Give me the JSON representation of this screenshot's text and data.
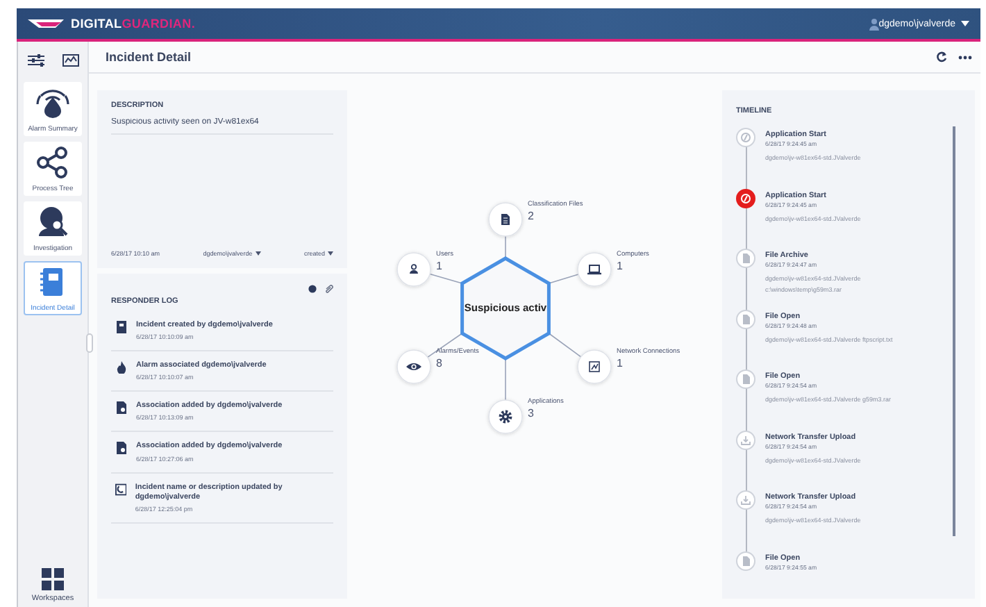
{
  "header": {
    "logo_primary": "DIGITAL",
    "logo_accent": "GUARDIAN.",
    "user": "dgdemo\\jvalverde"
  },
  "sidebar": {
    "tiles": [
      {
        "label": "Alarm Summary",
        "kind": "alarm",
        "selected": false
      },
      {
        "label": "Process Tree",
        "kind": "tree",
        "selected": false
      },
      {
        "label": "Investigation",
        "kind": "investigation",
        "selected": false
      },
      {
        "label": "Incident Detail",
        "kind": "incident",
        "selected": true
      }
    ],
    "workspaces": "Workspaces"
  },
  "page_title": "Incident Detail",
  "description": {
    "heading": "DESCRIPTION",
    "text": "Suspicious activity seen on JV-w81ex64",
    "date": "6/28/17 10:10 am",
    "owner": "dgdemo\\jvalverde",
    "status": "created"
  },
  "responder_log": {
    "heading": "RESPONDER LOG",
    "entries": [
      {
        "kind": "incident",
        "text": "Incident created by dgdemo\\jvalverde",
        "time": "6/28/17 10:10:09 am"
      },
      {
        "kind": "alarm",
        "text": "Alarm associated dgdemo\\jvalverde",
        "time": "6/28/17 10:10:07 am"
      },
      {
        "kind": "association",
        "text": "Association added by dgdemo\\jvalverde",
        "time": "6/28/17 10:13:09 am"
      },
      {
        "kind": "association",
        "text": "Association added by dgdemo\\jvalverde",
        "time": "6/28/17 10:27:06 am"
      },
      {
        "kind": "update",
        "text": "Incident name or description updated by dgdemo\\jvalverde",
        "time": "6/28/17 12:25:04 pm"
      }
    ]
  },
  "graph": {
    "center": "Suspicious activ",
    "nodes": [
      {
        "kind": "files",
        "label": "Classification Files",
        "count": "2"
      },
      {
        "kind": "users",
        "label": "Users",
        "count": "1"
      },
      {
        "kind": "computers",
        "label": "Computers",
        "count": "1"
      },
      {
        "kind": "alarms",
        "label": "Alarms/Events",
        "count": "8"
      },
      {
        "kind": "network",
        "label": "Network Connections",
        "count": "1"
      },
      {
        "kind": "applications",
        "label": "Applications",
        "count": "3"
      }
    ]
  },
  "timeline": {
    "heading": "TIMELINE",
    "events": [
      {
        "kind": "app",
        "alert": false,
        "title": "Application Start",
        "time": "6/28/17 9:24:45 am",
        "details": [
          "dgdemo\\jv-w81ex64-std.JValverde"
        ]
      },
      {
        "kind": "app",
        "alert": true,
        "title": "Application Start",
        "time": "6/28/17 9:24:45 am",
        "details": [
          "dgdemo\\jv-w81ex64-std.JValverde"
        ]
      },
      {
        "kind": "file",
        "alert": false,
        "title": "File Archive",
        "time": "6/28/17 9:24:47 am",
        "details": [
          "dgdemo\\jv-w81ex64-std.JValverde",
          "c:\\windows\\temp\\g59m3.rar"
        ]
      },
      {
        "kind": "file",
        "alert": false,
        "title": "File Open",
        "time": "6/28/17 9:24:48 am",
        "details": [
          "dgdemo\\jv-w81ex64-std.JValverde ftpscript.txt"
        ]
      },
      {
        "kind": "file",
        "alert": false,
        "title": "File Open",
        "time": "6/28/17 9:24:54 am",
        "details": [
          "dgdemo\\jv-w81ex64-std.JValverde g59m3.rar"
        ]
      },
      {
        "kind": "upload",
        "alert": false,
        "title": "Network Transfer Upload",
        "time": "6/28/17 9:24:54 am",
        "details": [
          "dgdemo\\jv-w81ex64-std.JValverde"
        ]
      },
      {
        "kind": "upload",
        "alert": false,
        "title": "Network Transfer Upload",
        "time": "6/28/17 9:24:54 am",
        "details": [
          "dgdemo\\jv-w81ex64-std.JValverde"
        ]
      },
      {
        "kind": "file",
        "alert": false,
        "title": "File Open",
        "time": "6/28/17 9:24:55 am"
      }
    ]
  }
}
